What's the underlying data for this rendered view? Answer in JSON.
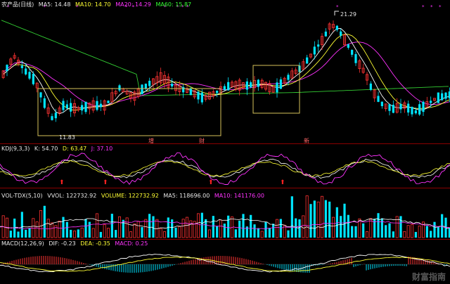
{
  "price_header": {
    "name": "农产品(日线)",
    "ma5": "MA5: 14.48",
    "ma10": "MA10: 14.70",
    "ma20": "MA20: 14.29",
    "ma60": "MA60: 15.87"
  },
  "kdj_header": {
    "name": "KDJ(9,3,3)",
    "k": "K: 54.70",
    "d": "D: 63.47",
    "j": "J: 37.10"
  },
  "vol_header": {
    "name": "VOL-TDX(5,10)",
    "vvol": "VVOL: 122732.92",
    "volume": "VOLUME: 122732.92",
    "ma5": "MA5: 118696.00",
    "ma10": "MA10: 141176.00"
  },
  "macd_header": {
    "name": "MACD(12,26,9)",
    "dif": "DIF: -0.23",
    "dea": "DEA: -0.35",
    "macd": "MACD: 0.25"
  },
  "annotations": {
    "high_label": "21.29",
    "low_label": "11.83",
    "mark_zeng": "增",
    "mark_cai": "财",
    "mark_xin": "新"
  },
  "watermark": "财富指南",
  "colors": {
    "up": "#ff3333",
    "down": "#00e5ff",
    "ma5": "#ffffff",
    "ma10": "#ffff33",
    "ma20": "#ff33ff",
    "ma60": "#33cc33",
    "box": "#d6c25a",
    "separator": "#8b0000"
  }
}
